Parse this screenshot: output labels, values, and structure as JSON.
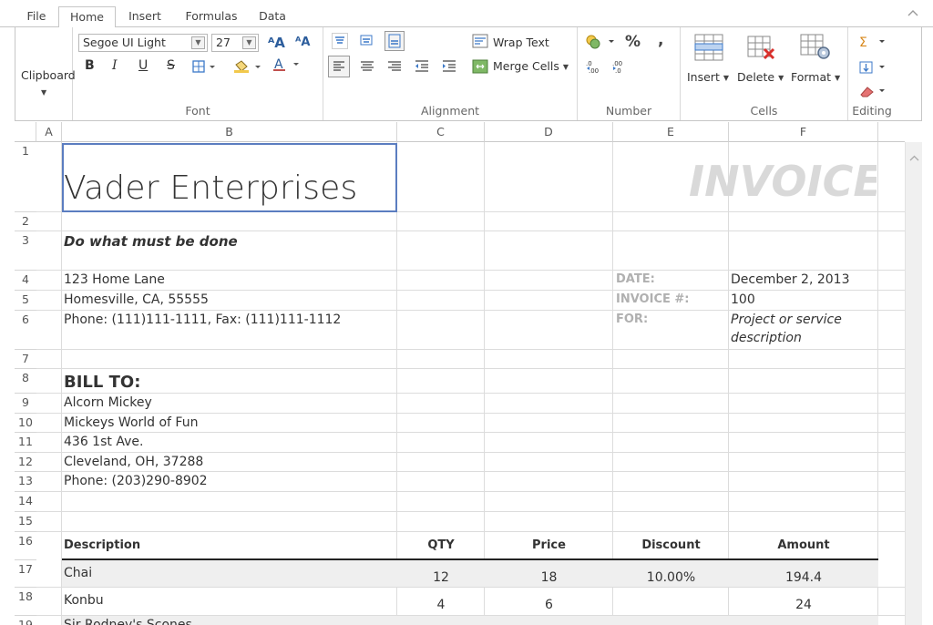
{
  "tabs": [
    {
      "label": "File"
    },
    {
      "label": "Home"
    },
    {
      "label": "Insert"
    },
    {
      "label": "Formulas"
    },
    {
      "label": "Data"
    }
  ],
  "ribbon": {
    "clipboard": {
      "label": "Clipboard"
    },
    "font": {
      "label": "Font",
      "family": "Segoe UI Light",
      "size": "27"
    },
    "alignment": {
      "label": "Alignment",
      "wrap_text": "Wrap Text",
      "merge_cells": "Merge Cells"
    },
    "number": {
      "label": "Number",
      "percent": "%",
      "comma": ","
    },
    "cells": {
      "label": "Cells",
      "insert": "Insert",
      "delete": "Delete",
      "format": "Format"
    },
    "editing": {
      "label": "Editing"
    }
  },
  "columns": [
    "A",
    "B",
    "C",
    "D",
    "E",
    "F"
  ],
  "rows": [
    "1",
    "2",
    "3",
    "4",
    "5",
    "6",
    "7",
    "8",
    "9",
    "10",
    "11",
    "12",
    "13",
    "14",
    "15",
    "16",
    "17",
    "18",
    "19"
  ],
  "sheet": {
    "company": "Vader Enterprises",
    "invoice_title": "INVOICE",
    "slogan": "Do what must be done",
    "address1": "123 Home Lane",
    "address2": "Homesville, CA, 55555",
    "phone": "Phone: (111)111-1111, Fax: (111)111-1112",
    "date_label": "DATE:",
    "date_value": "December 2, 2013",
    "invoice_no_label": "INVOICE #:",
    "invoice_no_value": "100",
    "for_label": "FOR:",
    "for_value_1": "Project or service",
    "for_value_2": "description",
    "bill_to": "BILL TO:",
    "bill_name": "Alcorn Mickey",
    "bill_company": "Mickeys World of Fun",
    "bill_address": "436 1st Ave.",
    "bill_city": "Cleveland, OH, 37288",
    "bill_phone": "Phone: (203)290-8902",
    "headers": {
      "description": "Description",
      "qty": "QTY",
      "price": "Price",
      "discount": "Discount",
      "amount": "Amount"
    },
    "items": [
      {
        "description": "Chai",
        "qty": "12",
        "price": "18",
        "discount": "10.00%",
        "amount": "194.4"
      },
      {
        "description": "Konbu",
        "qty": "4",
        "price": "6",
        "discount": "",
        "amount": "24"
      }
    ],
    "partial_row": "Sir Rodney's Scones"
  },
  "colors": {
    "selection": "#5b7dc0",
    "invoice_title": "#d9d9d9",
    "label_gray": "#b0b0b0",
    "accent_blue": "#3c79c8"
  }
}
